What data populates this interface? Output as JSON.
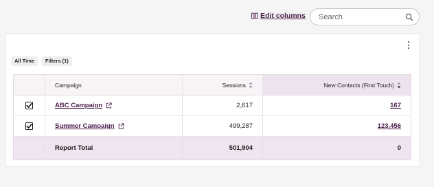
{
  "toolbar": {
    "edit_columns_label": "Edit columns",
    "search_placeholder": "Search",
    "edit_columns_icon": "columns-icon",
    "search_icon": "search-icon"
  },
  "filters": {
    "chips": [
      "All Time",
      "Filters (1)"
    ]
  },
  "table": {
    "columns": [
      "Campaign",
      "Sessions",
      "New Contacts (First Touch)"
    ],
    "rows": [
      {
        "campaign": "ABC Campaign",
        "sessions": "2,617",
        "new_contacts": "167",
        "checked": true
      },
      {
        "campaign": "Summer Campaign",
        "sessions": "499,287",
        "new_contacts": "123,456",
        "checked": true
      }
    ],
    "total": {
      "label": "Report Total",
      "sessions": "501,904",
      "new_contacts": "0"
    }
  },
  "colors": {
    "accent": "#4a1f4b",
    "header_bg": "#f7f3f7",
    "sorted_header_bg": "#eee2ee",
    "total_bg": "#efe4ef"
  }
}
